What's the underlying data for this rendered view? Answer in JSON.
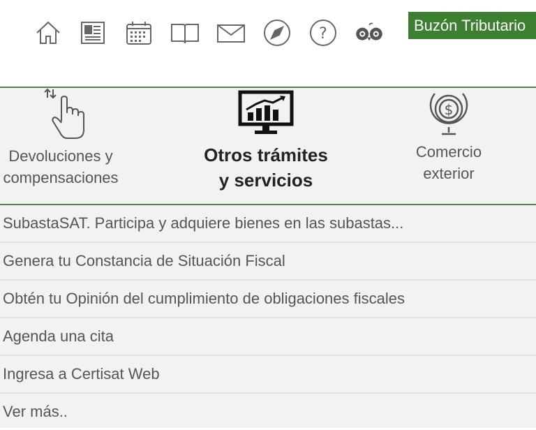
{
  "header": {
    "icons": [
      "home-icon",
      "newspaper-icon",
      "calendar-icon",
      "book-icon",
      "mail-icon",
      "compass-icon",
      "help-icon",
      "owl-icon"
    ],
    "buzon_label": "Buzón Tributario",
    "accent_color": "#3d7f31"
  },
  "categories": [
    {
      "line1": "Devoluciones y",
      "line2": "compensaciones",
      "icon": "hand-pointer-icon"
    },
    {
      "line1": "Otros trámites",
      "line2": "y servicios",
      "icon": "monitor-chart-icon",
      "active": true
    },
    {
      "line1": "Comercio",
      "line2": "exterior",
      "icon": "globe-dollar-icon"
    }
  ],
  "links": [
    "SubastaSAT. Participa y adquiere bienes en las subastas...",
    "Genera tu Constancia de Situación Fiscal",
    "Obtén tu Opinión del cumplimiento de obligaciones fiscales",
    "Agenda una cita",
    "Ingresa a Certisat Web",
    "Ver más.."
  ]
}
